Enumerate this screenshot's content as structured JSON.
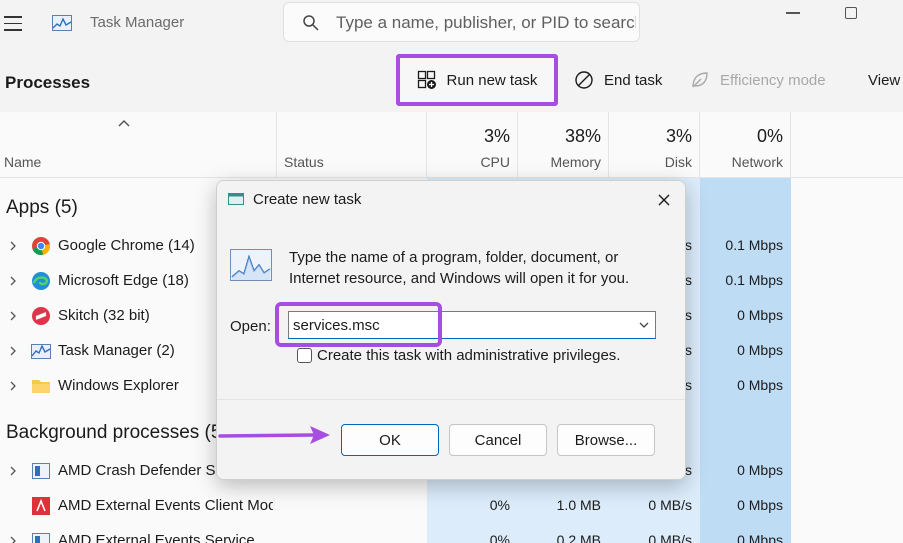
{
  "window": {
    "title": "Task Manager",
    "search_placeholder": "Type a name, publisher, or PID to search"
  },
  "toolbar": {
    "section_title": "Processes",
    "run_new_task": "Run new task",
    "end_task": "End task",
    "efficiency_mode": "Efficiency mode",
    "view": "View"
  },
  "header": {
    "name": "Name",
    "status": "Status",
    "cpu_pct": "3%",
    "cpu": "CPU",
    "memory_pct": "38%",
    "memory": "Memory",
    "disk_pct": "3%",
    "disk": "Disk",
    "network_pct": "0%",
    "network": "Network"
  },
  "groups": {
    "apps": "Apps (5)",
    "background": "Background processes (5"
  },
  "apps": [
    {
      "name": "Google Chrome (14)",
      "disk": "s",
      "network": "0.1 Mbps"
    },
    {
      "name": "Microsoft Edge (18)",
      "disk": "s",
      "network": "0.1 Mbps"
    },
    {
      "name": "Skitch (32 bit)",
      "disk": "s",
      "network": "0 Mbps"
    },
    {
      "name": "Task Manager (2)",
      "disk": "s",
      "network": "0 Mbps"
    },
    {
      "name": "Windows Explorer",
      "disk": "s",
      "network": "0 Mbps"
    }
  ],
  "background": [
    {
      "name": "AMD Crash Defender Service",
      "cpu": "",
      "memory": "",
      "disk": "s",
      "network": "0 Mbps"
    },
    {
      "name": "AMD External Events Client Module",
      "cpu": "0%",
      "memory": "1.0 MB",
      "disk": "0 MB/s",
      "network": "0 Mbps"
    },
    {
      "name": "AMD External Events Service",
      "cpu": "0%",
      "memory": "0.2 MB",
      "disk": "0 MB/s",
      "network": "0 Mbps"
    }
  ],
  "dialog": {
    "title": "Create new task",
    "description": "Type the name of a program, folder, document, or Internet resource, and Windows will open it for you.",
    "open_label": "Open:",
    "open_value": "services.msc",
    "admin_label": "Create this task with administrative privileges.",
    "ok": "OK",
    "cancel": "Cancel",
    "browse": "Browse..."
  },
  "colors": {
    "highlight": "#a64ee0",
    "accent": "#0067c0",
    "column_light": "#dcecfb",
    "column_dark": "#bfdcf5"
  }
}
